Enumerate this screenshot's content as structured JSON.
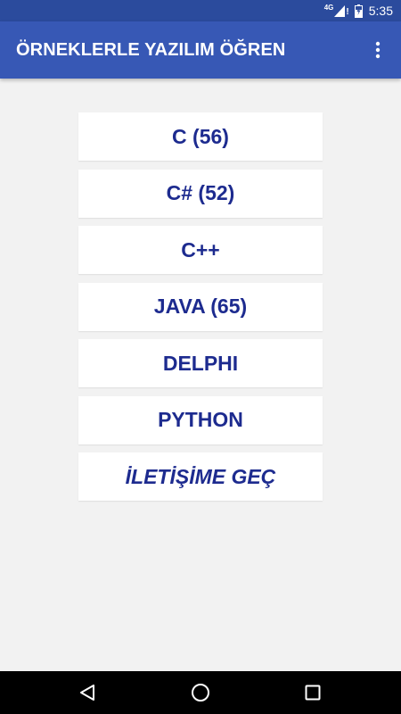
{
  "status_bar": {
    "network": "4G",
    "alert": "!",
    "time": "5:35"
  },
  "app_bar": {
    "title": "ÖRNEKLERLE YAZILIM ÖĞREN",
    "overflow_icon": "more-vert-icon"
  },
  "menu": {
    "items": [
      {
        "label": "C (56)",
        "italic": false
      },
      {
        "label": "C# (52)",
        "italic": false
      },
      {
        "label": "C++",
        "italic": false
      },
      {
        "label": "JAVA (65)",
        "italic": false
      },
      {
        "label": "DELPHI",
        "italic": false
      },
      {
        "label": "PYTHON",
        "italic": false
      },
      {
        "label": "İLETİŞİME GEÇ",
        "italic": true
      }
    ]
  },
  "nav_bar": {
    "back_icon": "back-triangle-icon",
    "home_icon": "home-circle-icon",
    "recents_icon": "recents-square-icon"
  },
  "colors": {
    "status_bar": "#2b4b9d",
    "app_bar": "#3758b5",
    "background": "#f2f2f2",
    "button_text": "#1d2b8f",
    "button_bg": "#ffffff"
  }
}
